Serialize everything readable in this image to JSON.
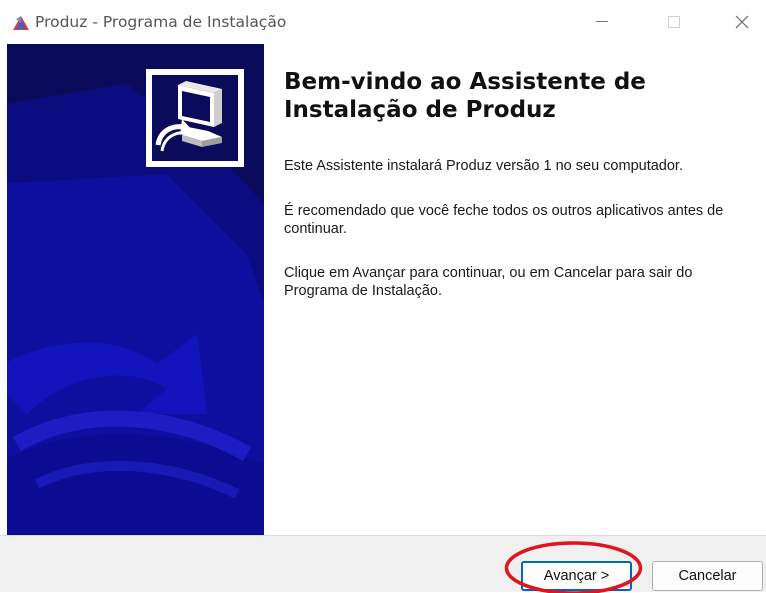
{
  "window": {
    "title": "Produz - Programa de Instalação",
    "icons": {
      "app": "installer-app-icon",
      "minimize": "minimize-icon",
      "maximize": "maximize-icon",
      "close": "close-icon"
    }
  },
  "content": {
    "heading": "Bem-vindo ao Assistente de Instalação de Produz",
    "paragraph1": "Este Assistente instalará Produz versão 1 no seu computador.",
    "paragraph2": "É recomendado que você feche todos os outros aplicativos antes de continuar.",
    "paragraph3": "Clique em Avançar para continuar, ou em Cancelar para sair do Programa de Instalação."
  },
  "buttons": {
    "next_label": "Avançar >",
    "cancel_label": "Cancelar"
  },
  "colors": {
    "side_panel": "#0b0b5c",
    "accent_border": "#0067c0",
    "highlight_circle": "#e0141e"
  }
}
